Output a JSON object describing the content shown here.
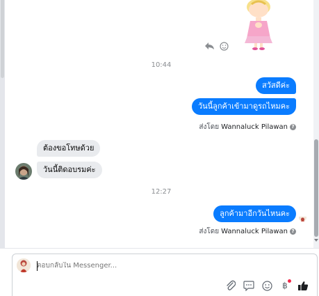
{
  "conversation": {
    "timestamps": [
      "10:44",
      "12:27"
    ],
    "outgoing_1": [
      "สวัสดีค่ะ",
      "วันนี้ลูกค้าเข้ามาดูรถไหมคะ"
    ],
    "outgoing_2": [
      "ลูกค้ามาอีกวันไหนคะ"
    ],
    "incoming_1": [
      "ต้องขอโทษด้วย",
      "วันนี้ติดอบรมค่ะ"
    ],
    "sent_by_prefix": "ส่งโดย",
    "sent_by_name": "Wannaluck Pilawan",
    "info_glyph": "?"
  },
  "composer": {
    "placeholder": "ตอบกลับใน Messenger...",
    "tools": [
      "attach-icon",
      "gif-icon",
      "emoji-icon",
      "payment-icon",
      "like-icon"
    ],
    "baht_glyph": "฿"
  },
  "colors": {
    "outgoing_bubble": "#0a7cff",
    "incoming_bubble": "#e9ebee",
    "like": "#0a7cff",
    "notify_dot": "#f02849"
  }
}
